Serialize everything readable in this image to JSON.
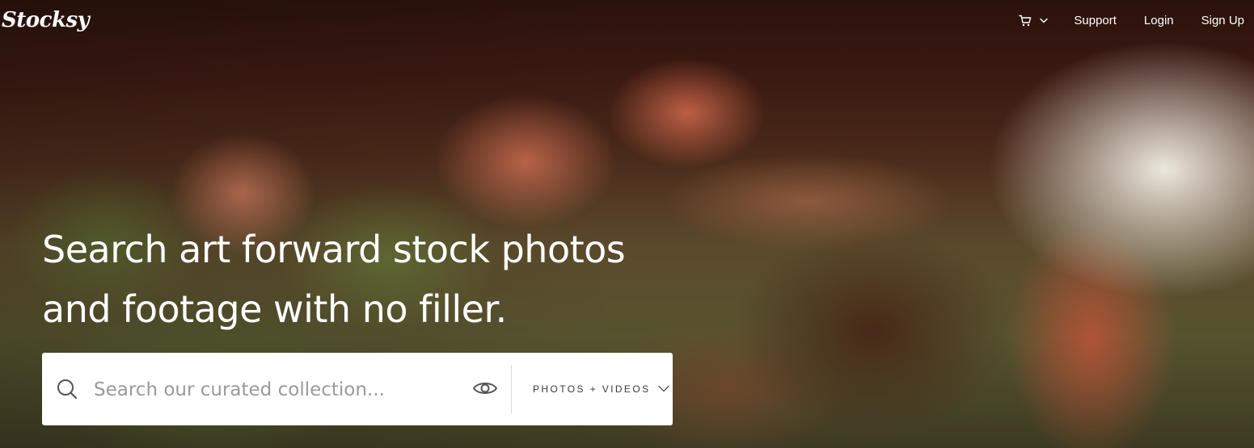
{
  "header": {
    "logo": "Stocksy",
    "cart_icon": "cart-icon",
    "cart_dropdown_icon": "chevron-down-icon",
    "nav": {
      "support": "Support",
      "login": "Login",
      "signup": "Sign Up"
    }
  },
  "hero": {
    "headline_line1": "Search art forward stock photos",
    "headline_line2": "and footage with no filler."
  },
  "search": {
    "icon": "search-icon",
    "placeholder": "Search our curated collection...",
    "visual_search_icon": "eye-icon",
    "media_type": {
      "selected": "PHOTOS + VIDEOS",
      "icon": "chevron-down-icon"
    }
  },
  "colors": {
    "text_on_image": "#ffffff",
    "search_bg": "#ffffff",
    "placeholder": "#9a9a9a",
    "divider": "#d8d8d8"
  }
}
